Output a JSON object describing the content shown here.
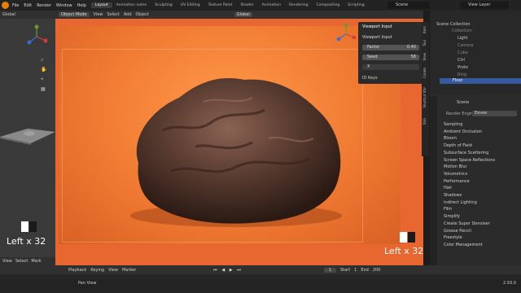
{
  "menu": {
    "items": [
      "File",
      "Edit",
      "Render",
      "Window",
      "Help"
    ]
  },
  "workspaces": [
    "Layout",
    "Animation notes",
    "Sculpting",
    "UV Editing",
    "Texture Paint",
    "Shader",
    "Animation",
    "Rendering",
    "Compositing",
    "Scripting"
  ],
  "active_workspace": "Layout",
  "scene_name": "Scene",
  "view_layer": "View Layer",
  "left_header": {
    "transform": "Global"
  },
  "viewport_header": {
    "mode": "Object Mode",
    "view": "View",
    "select": "Select",
    "add": "Add",
    "object": "Object",
    "orientation": "Global"
  },
  "n_panel": {
    "title": "Viewport Input",
    "subheader": "Viewport Input",
    "factor_label": "Factor",
    "factor_value": "0.40",
    "seed_label": "Seed",
    "seed_value": "58",
    "x_label": "X",
    "id_keys": "ID Keys"
  },
  "vertical_tabs": [
    "Item",
    "Tool",
    "View",
    "Create",
    "Shortcut VUr",
    "SSG"
  ],
  "outliner": {
    "root": "Scene Collection",
    "items": [
      "Collection",
      "Light",
      "Camera",
      "Cube",
      "Ctrl",
      "Proto",
      "Ring",
      "Floor"
    ]
  },
  "properties": {
    "title": "Scene",
    "render_engine_label": "Render Engine",
    "render_engine": "Eevee",
    "sections": [
      "Sampling",
      "Ambient Occlusion",
      "Bloom",
      "Depth of Field",
      "Subsurface Scattering",
      "Screen Space Reflections",
      "Motion Blur",
      "Volumetrics",
      "Performance",
      "Hair",
      "Shadows",
      "Indirect Lighting",
      "Film",
      "Simplify",
      "Create Super Denoiser",
      "Grease Pencil",
      "Freestyle",
      "Color Management"
    ]
  },
  "overlay_text_left": "Left x 32",
  "overlay_text_right": "Left x 32",
  "timeline": {
    "playback": "Playback",
    "keying": "Keying",
    "view": "View",
    "marker": "Marker",
    "current_frame": "1",
    "start_label": "Start",
    "start": "1",
    "end_label": "End",
    "end": "200"
  },
  "left_bottom": {
    "view": "View",
    "select": "Select",
    "mark": "Mark"
  },
  "status": {
    "pan_view": "Pan View",
    "version": "2.93.0"
  },
  "colors": {
    "accent": "#e87d0d",
    "viewport_bg": "#e8662f",
    "panel": "#2b2b2b"
  }
}
